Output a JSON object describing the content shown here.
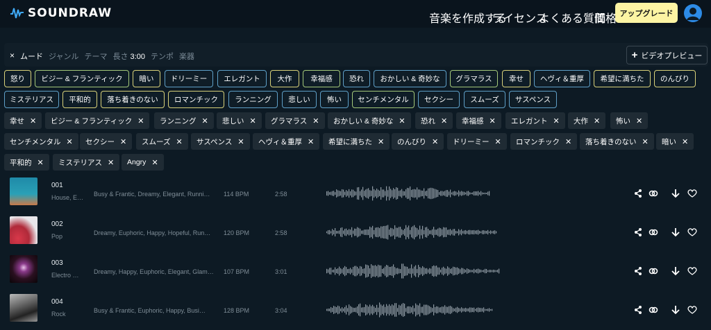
{
  "header": {
    "logo_text": "SOUNDRAW",
    "nav": [
      "音楽を作成する",
      "ライセンス",
      "よくある質問",
      "価格"
    ],
    "upgrade_label": "アップグレード"
  },
  "filter": {
    "close": "×",
    "tabs": [
      "ムード",
      "ジャンル",
      "テーマ",
      "長さ",
      "テンポ",
      "楽器"
    ],
    "length_value": "3:00",
    "video_preview": "ビデオプレビュー"
  },
  "moods_row1": [
    "怒り",
    "ビジー & フランティック",
    "暗い",
    "ドリーミー",
    "エレガント",
    "大作",
    "幸福感",
    "恐れ",
    "おかしい & 奇妙な",
    "グラマラス",
    "幸せ",
    "ヘヴィ＆重厚",
    "希望に満ちた",
    "のんびり"
  ],
  "moods_row2": [
    "ミステリアス",
    "平和的",
    "落ち着きのない",
    "ロマンチック",
    "ランニング",
    "悲しい",
    "怖い",
    "センチメンタル",
    "セクシー",
    "スムーズ",
    "サスペンス"
  ],
  "selected_row1": [
    "幸せ",
    "ビジー & フランティック",
    "ランニング",
    "悲しい",
    "グラマラス",
    "おかしい & 奇妙な",
    "恐れ",
    "幸福感",
    "エレガント",
    "大作",
    "怖い"
  ],
  "selected_row2": [
    "センチメンタル",
    "セクシー",
    "スムーズ",
    "サスペンス",
    "ヘヴィ＆重厚",
    "希望に満ちた",
    "のんびり",
    "ドリーミー",
    "ロマンチック",
    "落ち着きのない",
    "暗い"
  ],
  "selected_row3": [
    "平和的",
    "ミステリアス",
    "Angry"
  ],
  "tracks": [
    {
      "num": "001",
      "genre": "House, E…",
      "tags": "Busy & Frantic, Dreamy, Elegant, Runni…",
      "bpm": "114 BPM",
      "length": "2:58"
    },
    {
      "num": "002",
      "genre": "Pop",
      "tags": "Dreamy, Euphoric, Happy, Hopeful, Run…",
      "bpm": "120 BPM",
      "length": "2:58"
    },
    {
      "num": "003",
      "genre": "Electro …",
      "tags": "Dreamy, Happy, Euphoric, Elegant, Glam…",
      "bpm": "107 BPM",
      "length": "3:01"
    },
    {
      "num": "004",
      "genre": "Rock",
      "tags": "Busy & Frantic, Euphoric, Happy, Busi…",
      "bpm": "128 BPM",
      "length": "3:04"
    }
  ],
  "colors": {
    "accent": "#fdf4a3",
    "avatar": "#2d8be6",
    "bg": "#0d1a24"
  }
}
